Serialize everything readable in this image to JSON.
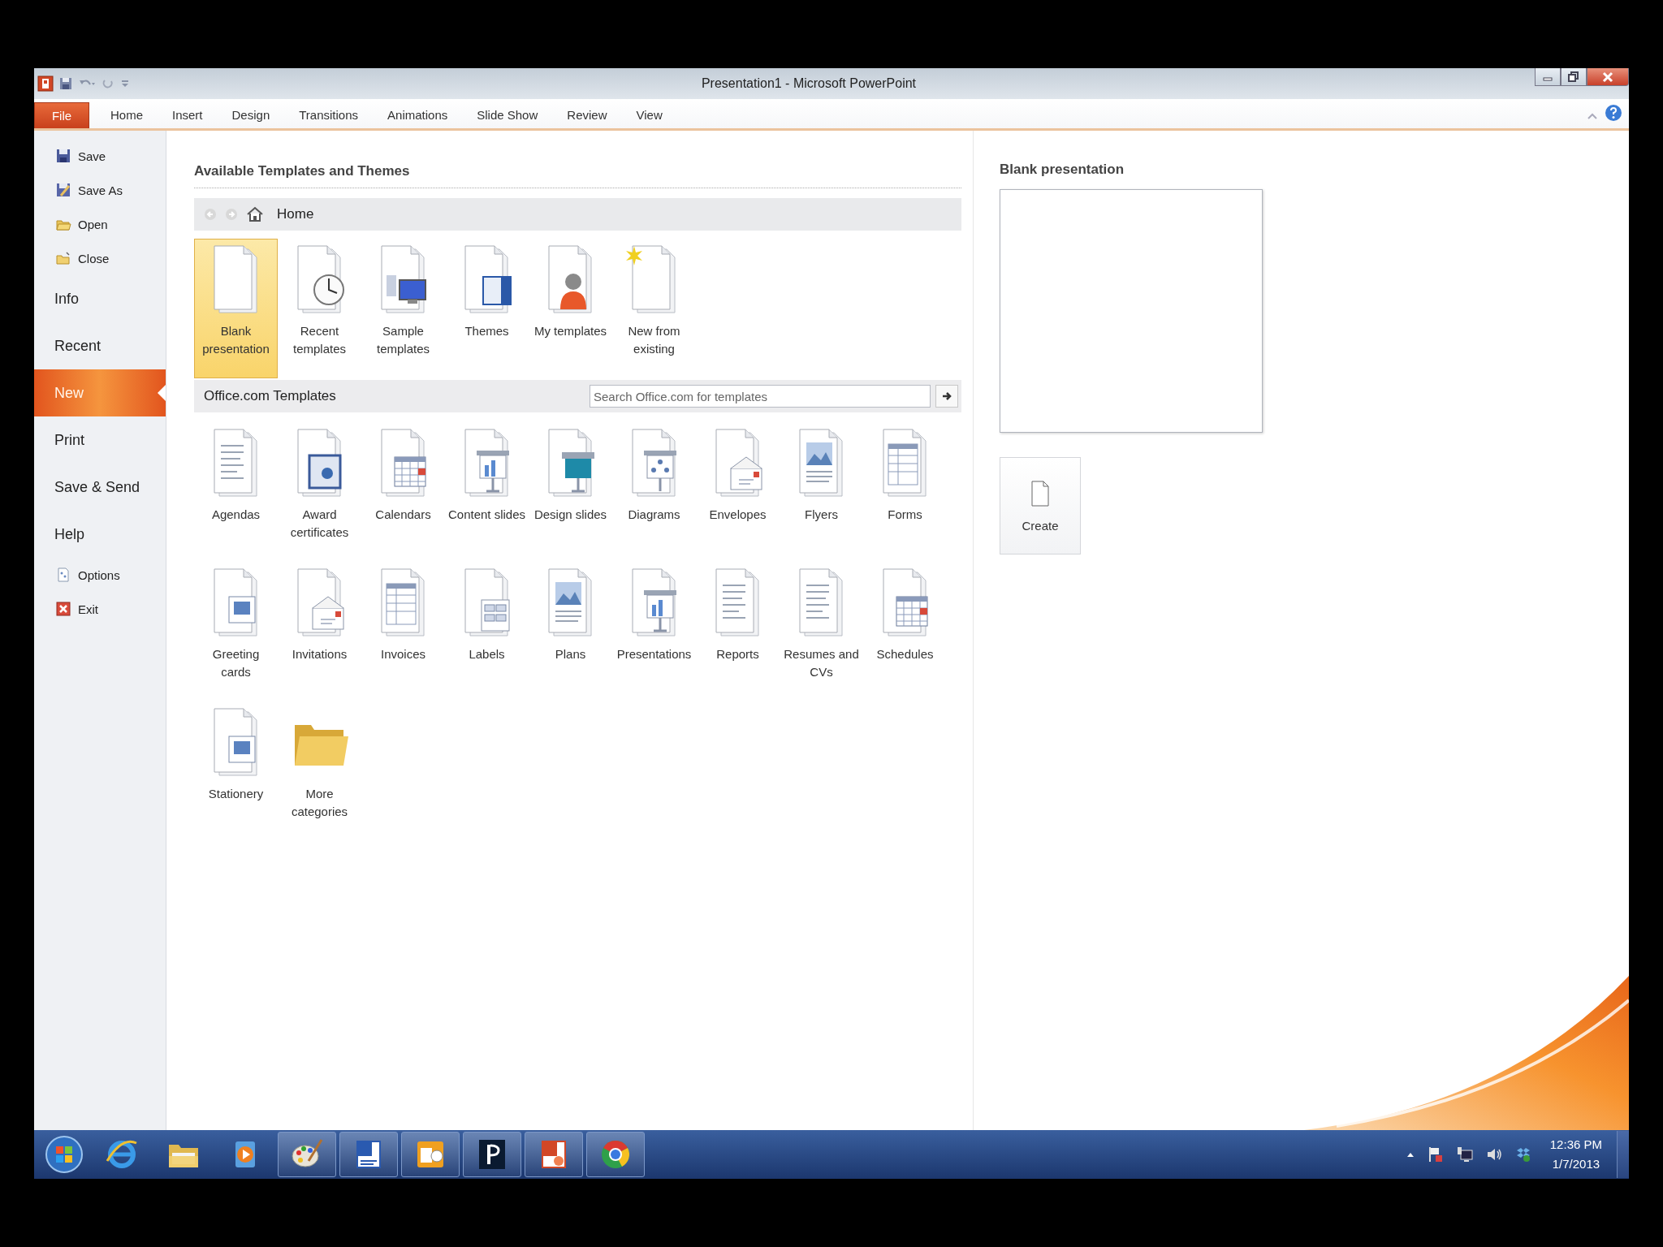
{
  "window": {
    "title": "Presentation1 - Microsoft PowerPoint"
  },
  "ribbon": {
    "file_tab": "File",
    "tabs": [
      {
        "label": "Home"
      },
      {
        "label": "Insert"
      },
      {
        "label": "Design"
      },
      {
        "label": "Transitions"
      },
      {
        "label": "Animations"
      },
      {
        "label": "Slide Show"
      },
      {
        "label": "Review"
      },
      {
        "label": "View"
      }
    ]
  },
  "backstage_nav": [
    {
      "kind": "save",
      "label": "Save",
      "selected": false
    },
    {
      "kind": "saveas",
      "label": "Save As",
      "selected": false
    },
    {
      "kind": "open",
      "label": "Open",
      "selected": false
    },
    {
      "kind": "close",
      "label": "Close",
      "selected": false
    },
    {
      "kind": "page",
      "label": "Info",
      "selected": false
    },
    {
      "kind": "page",
      "label": "Recent",
      "selected": false
    },
    {
      "kind": "page",
      "label": "New",
      "selected": true
    },
    {
      "kind": "page",
      "label": "Print",
      "selected": false
    },
    {
      "kind": "page",
      "label": "Save & Send",
      "selected": false
    },
    {
      "kind": "page",
      "label": "Help",
      "selected": false
    },
    {
      "kind": "options",
      "label": "Options",
      "selected": false
    },
    {
      "kind": "exit",
      "label": "Exit",
      "selected": false
    }
  ],
  "available": {
    "title": "Available Templates and Themes",
    "breadcrumb": "Home",
    "templates": [
      {
        "kind": "blank",
        "label": "Blank presentation",
        "selected": true
      },
      {
        "kind": "recent",
        "label": "Recent templates",
        "selected": false
      },
      {
        "kind": "sample",
        "label": "Sample templates",
        "selected": false
      },
      {
        "kind": "themes",
        "label": "Themes",
        "selected": false
      },
      {
        "kind": "mine",
        "label": "My templates",
        "selected": false
      },
      {
        "kind": "existing",
        "label": "New from existing",
        "selected": false
      }
    ]
  },
  "office": {
    "title": "Office.com Templates",
    "search": {
      "placeholder": "Search Office.com for templates"
    },
    "categories": [
      {
        "kind": "lines",
        "label": "Agendas"
      },
      {
        "kind": "award",
        "label": "Award certificates"
      },
      {
        "kind": "calendar",
        "label": "Calendars"
      },
      {
        "kind": "easel",
        "label": "Content slides"
      },
      {
        "kind": "screen",
        "label": "Design slides"
      },
      {
        "kind": "diagram",
        "label": "Diagrams"
      },
      {
        "kind": "envelope",
        "label": "Envelopes"
      },
      {
        "kind": "picture",
        "label": "Flyers"
      },
      {
        "kind": "table",
        "label": "Forms"
      },
      {
        "kind": "card",
        "label": "Greeting cards"
      },
      {
        "kind": "envelope",
        "label": "Invitations"
      },
      {
        "kind": "table",
        "label": "Invoices"
      },
      {
        "kind": "labels",
        "label": "Labels"
      },
      {
        "kind": "picture",
        "label": "Plans"
      },
      {
        "kind": "easel",
        "label": "Presentations"
      },
      {
        "kind": "lines",
        "label": "Reports"
      },
      {
        "kind": "lines",
        "label": "Resumes and CVs"
      },
      {
        "kind": "calendar",
        "label": "Schedules"
      },
      {
        "kind": "card",
        "label": "Stationery"
      },
      {
        "kind": "folder",
        "label": "More categories"
      }
    ]
  },
  "preview": {
    "title": "Blank presentation",
    "create_button": "Create"
  },
  "taskbar": {
    "apps": [
      {
        "kind": "browser",
        "running": false
      },
      {
        "kind": "folder",
        "running": false
      },
      {
        "kind": "player",
        "running": false
      },
      {
        "kind": "palette",
        "running": true
      },
      {
        "kind": "worddoc",
        "running": true
      },
      {
        "kind": "mail",
        "running": true
      },
      {
        "kind": "publisher",
        "running": true
      },
      {
        "kind": "slides",
        "running": true
      },
      {
        "kind": "chrome",
        "running": true
      }
    ],
    "time": "12:36 PM",
    "date": "1/7/2013"
  }
}
